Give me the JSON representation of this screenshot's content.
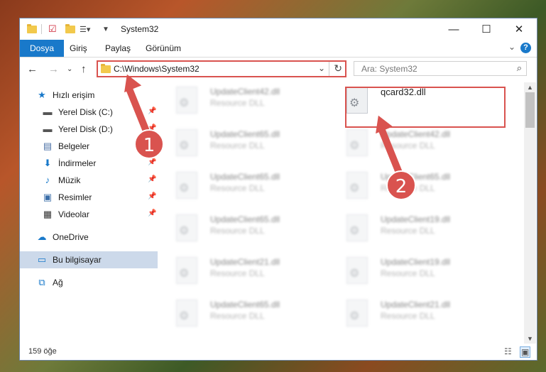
{
  "window": {
    "title": "System32",
    "controls": {
      "minimize": "—",
      "maximize": "☐",
      "close": "✕"
    }
  },
  "ribbon": {
    "tabs": [
      "Dosya",
      "Giriş",
      "Paylaş",
      "Görünüm"
    ],
    "help": "?"
  },
  "address": {
    "path": "C:\\Windows\\System32",
    "search_placeholder": "Ara: System32"
  },
  "sidebar": {
    "items": [
      {
        "label": "Hızlı erişim",
        "icon": "star-icon",
        "pinned": false
      },
      {
        "label": "Yerel Disk (C:)",
        "icon": "drive-icon",
        "pinned": true
      },
      {
        "label": "Yerel Disk (D:)",
        "icon": "drive-icon",
        "pinned": true
      },
      {
        "label": "Belgeler",
        "icon": "documents-icon",
        "pinned": true
      },
      {
        "label": "İndirmeler",
        "icon": "download-icon",
        "pinned": true
      },
      {
        "label": "Müzik",
        "icon": "music-icon",
        "pinned": true
      },
      {
        "label": "Resimler",
        "icon": "pictures-icon",
        "pinned": true
      },
      {
        "label": "Videolar",
        "icon": "videos-icon",
        "pinned": true
      },
      {
        "label": "OneDrive",
        "icon": "cloud-icon",
        "pinned": false
      },
      {
        "label": "Bu bilgisayar",
        "icon": "computer-icon",
        "pinned": false,
        "selected": true
      },
      {
        "label": "Ağ",
        "icon": "network-icon",
        "pinned": false
      }
    ]
  },
  "files": {
    "left": [
      {
        "name": "UpdateClient42.dll",
        "type": "Resource DLL"
      },
      {
        "name": "UpdateClient65.dll",
        "type": "Resource DLL"
      },
      {
        "name": "UpdateClient65.dll",
        "type": "Resource DLL"
      },
      {
        "name": "UpdateClient65.dll",
        "type": "Resource DLL"
      },
      {
        "name": "UpdateClient21.dll",
        "type": "Resource DLL"
      },
      {
        "name": "UpdateClient65.dll",
        "type": "Resource DLL"
      }
    ],
    "right": [
      {
        "name": "qcard32.dll",
        "type": "",
        "highlighted": true
      },
      {
        "name": "UpdateClient42.dll",
        "type": "Resource DLL"
      },
      {
        "name": "UpdateClient65.dll",
        "type": "Resource DLL"
      },
      {
        "name": "UpdateClient19.dll",
        "type": "Resource DLL"
      },
      {
        "name": "UpdateClient19.dll",
        "type": "Resource DLL"
      },
      {
        "name": "UpdateClient21.dll",
        "type": "Resource DLL"
      }
    ]
  },
  "status": {
    "count": "159 öğe"
  },
  "annotations": {
    "step1": "1",
    "step2": "2",
    "color": "#d9534f"
  }
}
